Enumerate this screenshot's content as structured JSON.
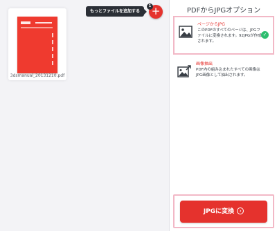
{
  "workspace": {
    "file": {
      "name": "3dsmanual_20131210.pdf"
    },
    "add_files": {
      "tooltip": "もっとファイルを追加する",
      "icon": "plus-icon",
      "badge_count": "1"
    }
  },
  "sidebar": {
    "title": "PDFからJPGオプション",
    "options": [
      {
        "title": "ページからJPG",
        "description": "このPDFのすべてのページは、JPGファイルに変換されます。92JPGが作成されます。",
        "icon": "image-icon",
        "selected": true
      },
      {
        "title": "画像抽出",
        "description": "PDF内の組み込まれたすべての画像はJPG画像として抽出されます。",
        "icon": "image-extract-icon",
        "selected": false
      }
    ],
    "convert_button": {
      "label": "JPGに変換",
      "icon": "arrow-right-circle-icon"
    }
  },
  "colors": {
    "accent": "#e5322d",
    "highlight": "#f2b8c6",
    "success": "#2dbd6e"
  }
}
